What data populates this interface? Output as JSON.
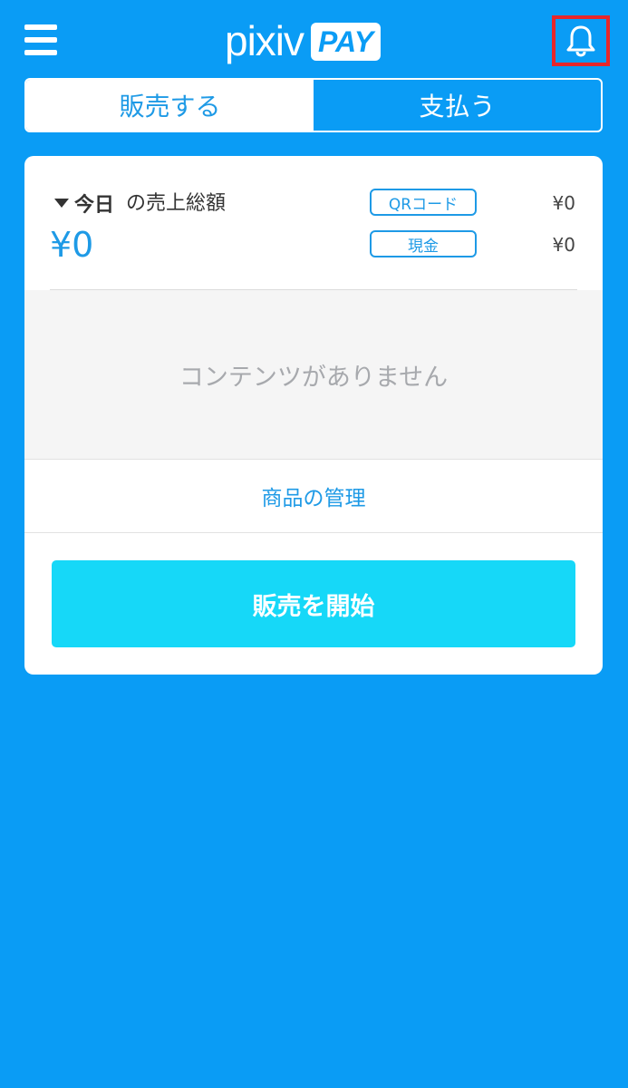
{
  "header": {
    "logo_text": "pixiv",
    "logo_badge": "PAY",
    "icons": {
      "menu": "hamburger-menu-icon",
      "notification": "bell-icon"
    },
    "highlight_color": "#e8262a"
  },
  "tabs": [
    {
      "label": "販売する",
      "active": true
    },
    {
      "label": "支払う",
      "active": false
    }
  ],
  "summary": {
    "period": "今日",
    "period_suffix": "の売上総額",
    "total": "¥0",
    "breakdown": [
      {
        "label": "QRコード",
        "amount": "¥0"
      },
      {
        "label": "現金",
        "amount": "¥0"
      }
    ]
  },
  "empty_message": "コンテンツがありません",
  "manage_link": "商品の管理",
  "start_button": "販売を開始",
  "colors": {
    "background": "#0a9cf5",
    "accent": "#1e9ae6",
    "start_button": "#16d8f8"
  }
}
